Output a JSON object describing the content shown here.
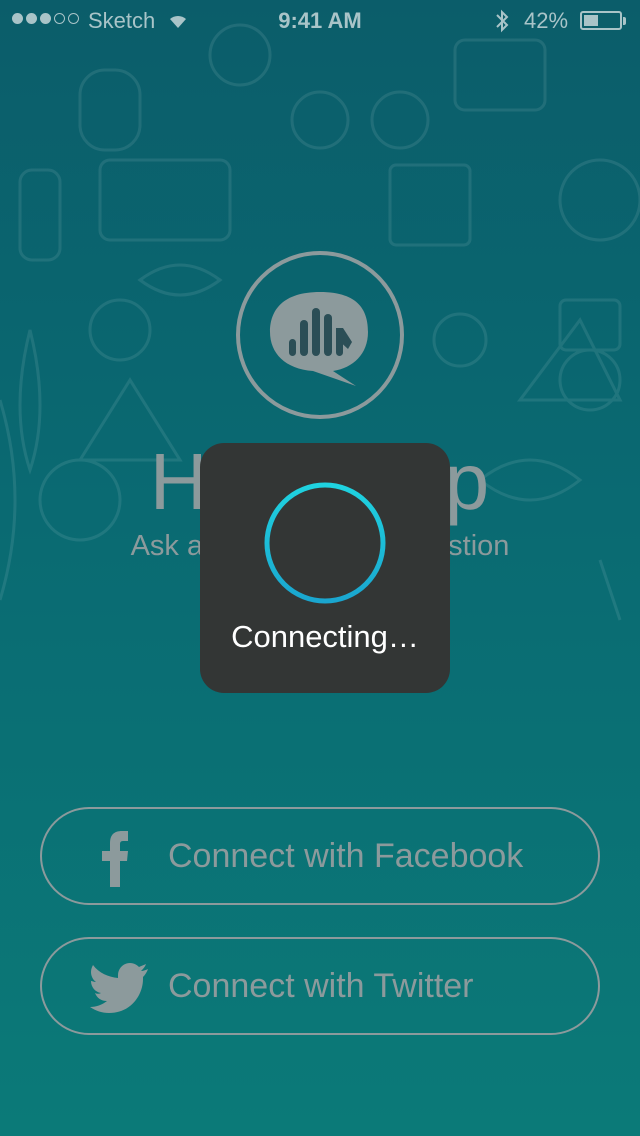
{
  "status_bar": {
    "carrier": "Sketch",
    "time": "9:41 AM",
    "battery_percent_text": "42%",
    "battery_level": 0.42,
    "signal_bars_filled": 3,
    "signal_bars_total": 5
  },
  "app": {
    "title": "HandsUp",
    "tagline": "Ask and answer any question"
  },
  "loading_overlay": {
    "message": "Connecting…",
    "accent_color": "#1fd3e0"
  },
  "buttons": {
    "facebook_label": "Connect with Facebook",
    "twitter_label": "Connect with Twitter"
  },
  "icons": {
    "logo": "speech-bubble-hand-icon",
    "facebook": "facebook-icon",
    "twitter": "twitter-bird-icon",
    "spinner": "loading-spinner-icon"
  },
  "colors": {
    "background_top": "#0b5d6a",
    "background_bottom": "#0b7a78",
    "muted_gray": "#8c9a9c",
    "hud_background": "#333635"
  }
}
